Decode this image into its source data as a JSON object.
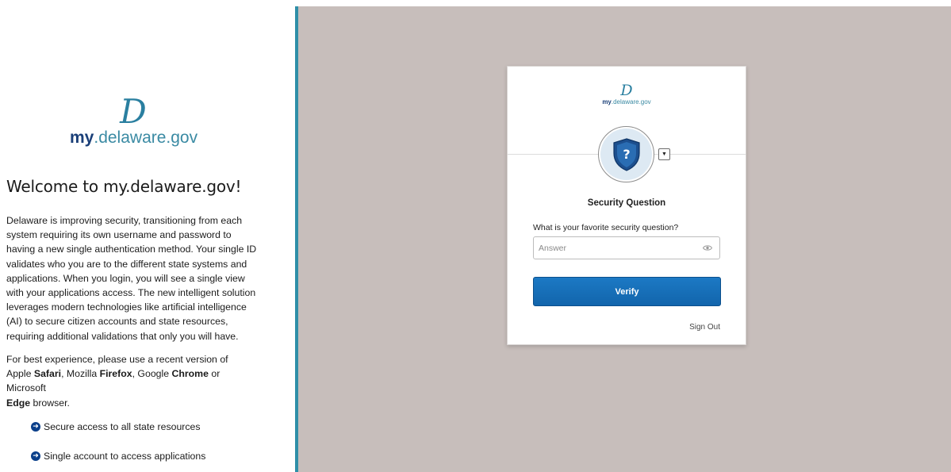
{
  "brand": {
    "glyph": "D",
    "name_bold": "my",
    "name_rest": ".delaware.gov"
  },
  "welcome": {
    "title": "Welcome to my.delaware.gov!",
    "intro": "Delaware is improving security, transitioning from each system requiring its own username and password to having a new single authentication method. Your single ID validates who you are to the different state systems and applications. When you login, you will see a single view with your applications access. The new intelligent solution leverages modern technologies like artificial intelligence (AI) to secure citizen accounts and state resources, requiring additional validations that only you will have.",
    "browser_note": {
      "part1": "For best experience, please use a recent version of Apple ",
      "safari": "Safari",
      "part2": ", Mozilla ",
      "firefox": "Firefox",
      "part3": ", Google ",
      "chrome": "Chrome",
      "part4": " or Microsoft ",
      "edge": "Edge",
      "part5": " browser."
    },
    "features": [
      "Secure access to all state resources",
      "Single account to access applications"
    ]
  },
  "card": {
    "factor_icon": "security-question-shield-icon",
    "heading": "Security Question",
    "question": "What is your favorite security question?",
    "answer": {
      "value": "",
      "placeholder": "Answer"
    },
    "verify_label": "Verify",
    "sign_out_label": "Sign Out"
  },
  "colors": {
    "divider": "#2f8fa8",
    "background": "#c7bebb",
    "button": "#1265ac",
    "brand_dark": "#1a3f78",
    "brand_light": "#3a8aa3"
  }
}
